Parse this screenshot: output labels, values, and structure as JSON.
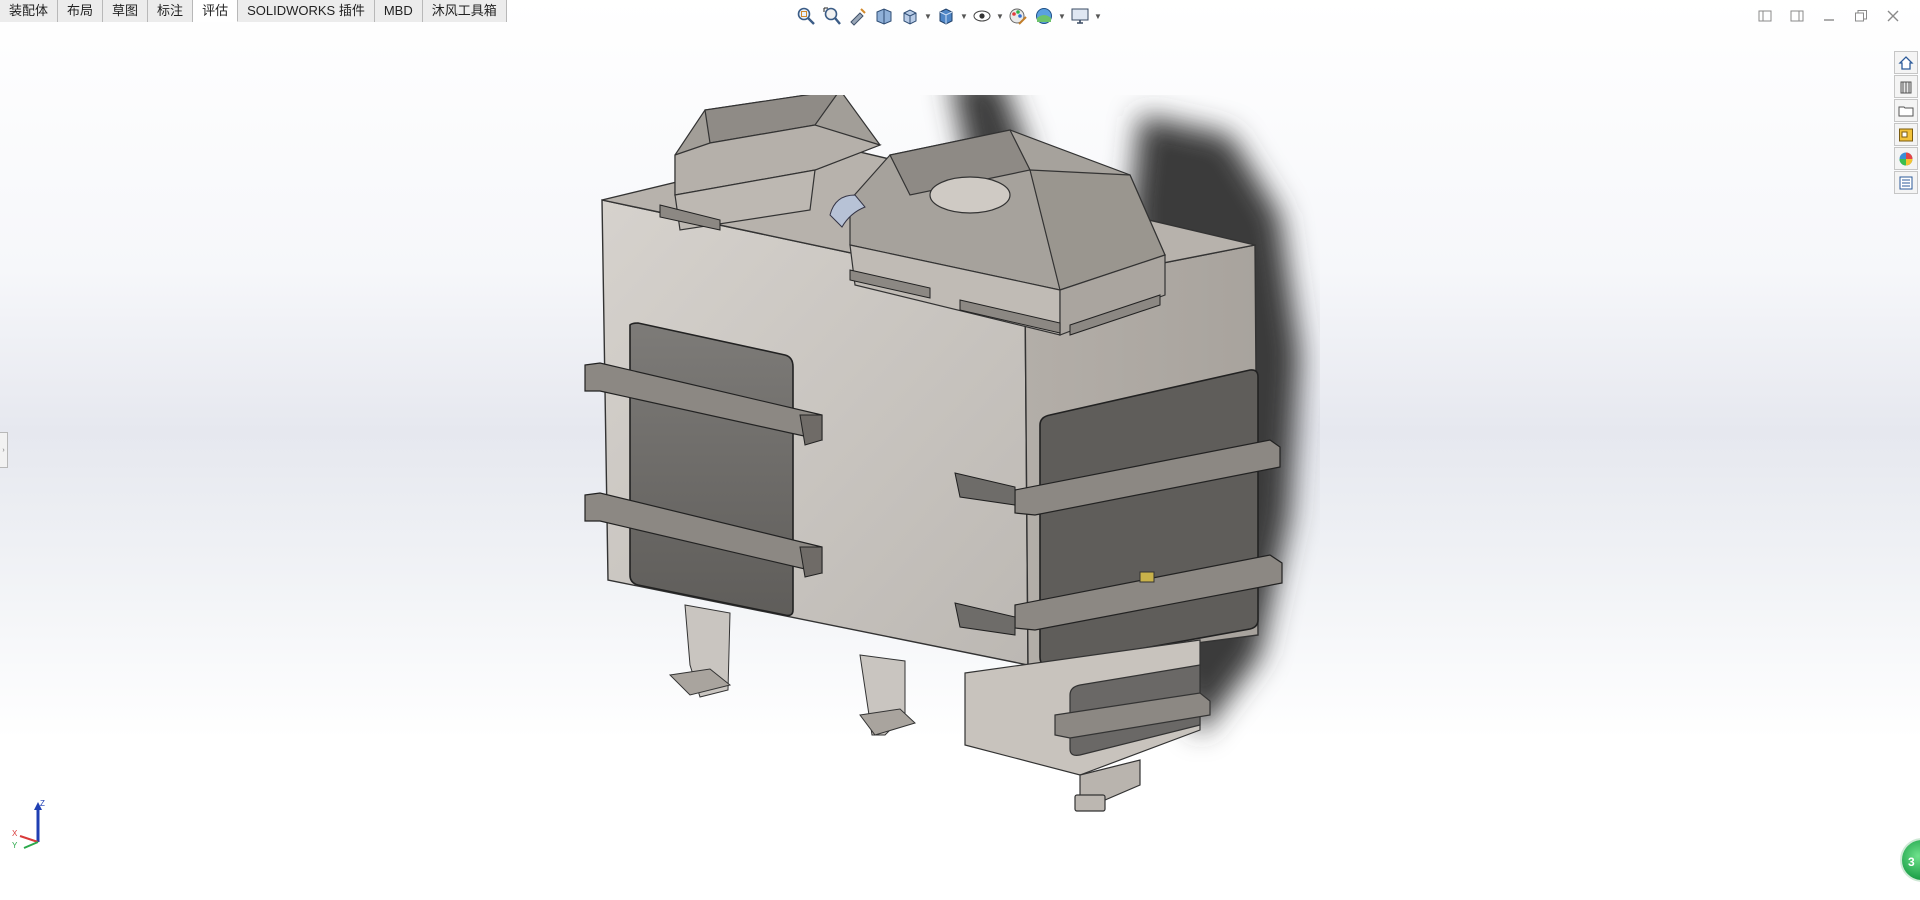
{
  "tabs": [
    {
      "label": "装配体",
      "active": false
    },
    {
      "label": "布局",
      "active": false
    },
    {
      "label": "草图",
      "active": false
    },
    {
      "label": "标注",
      "active": false
    },
    {
      "label": "评估",
      "active": true
    },
    {
      "label": "SOLIDWORKS 插件",
      "active": false
    },
    {
      "label": "MBD",
      "active": false
    },
    {
      "label": "沐风工具箱",
      "active": false
    }
  ],
  "hud_icons": [
    "zoom-to-fit-icon",
    "zoom-to-area-icon",
    "previous-view-icon",
    "section-view-icon",
    "view-orientation-icon",
    "display-style-icon",
    "hide-show-items-icon",
    "edit-appearance-icon",
    "apply-scene-icon",
    "view-settings-icon"
  ],
  "task_pane_icons": [
    "home-icon",
    "design-library-icon",
    "file-explorer-icon",
    "view-palette-icon",
    "appearances-icon",
    "custom-properties-icon"
  ],
  "triad": {
    "z": "Z",
    "x": "X",
    "y": "Y"
  },
  "orientation_badge": "3",
  "colors": {
    "tab_bg": "#ececec",
    "body_metal": "#c9c5c0",
    "door_dark": "#6a6866",
    "shadow": "#3a3a3a",
    "accent_blue": "#1f5fb4"
  }
}
